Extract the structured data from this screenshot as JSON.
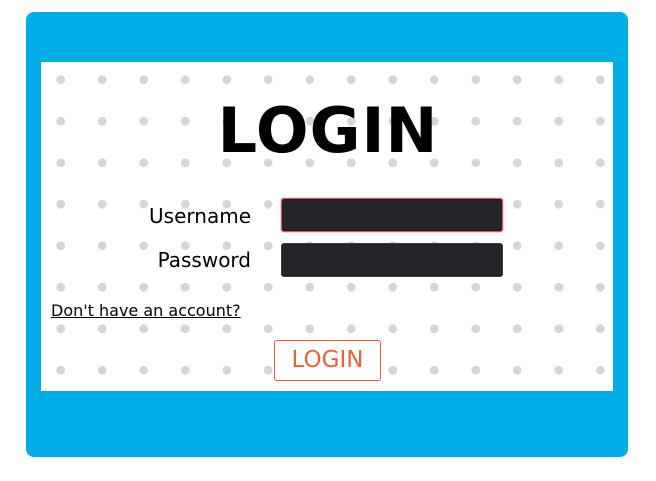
{
  "form": {
    "title": "LOGIN",
    "username_label": "Username",
    "username_value": "",
    "password_label": "Password",
    "password_value": "",
    "signup_link": "Don't have an account?",
    "submit_label": "LOGIN"
  },
  "colors": {
    "frame": "#00ade6",
    "panel": "#ffffff",
    "dots": "#d6d6d6",
    "input_bg": "#222428",
    "focus_border": "#e8535a",
    "button_accent": "#e8623a"
  }
}
